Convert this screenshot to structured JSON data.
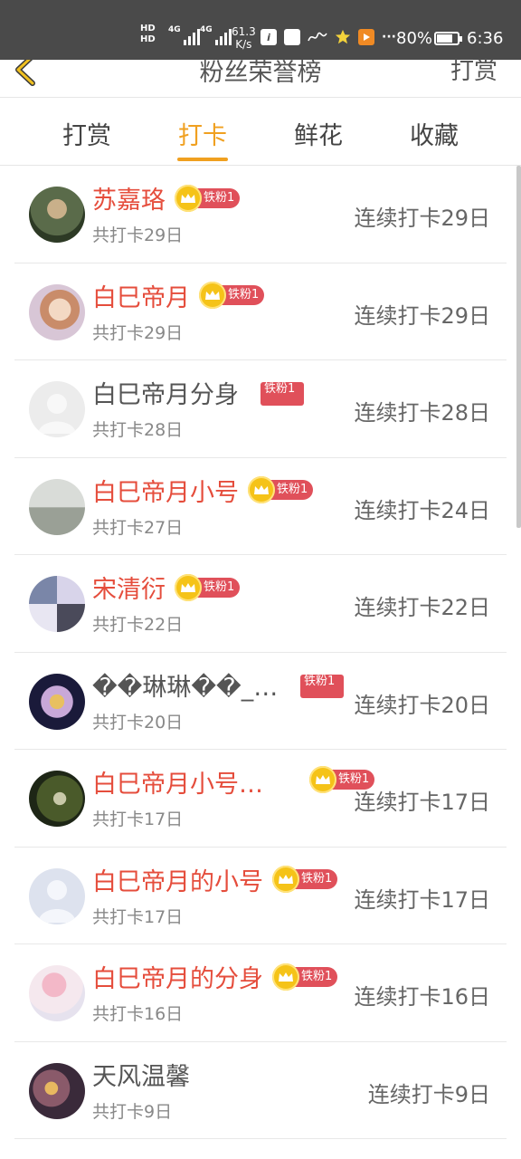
{
  "status_bar": {
    "hd1": "HD",
    "hd2": "HD",
    "net1": "4G",
    "net2": "4G",
    "speed_value": "61.3",
    "speed_unit": "K/s",
    "more": "···",
    "battery": "80%",
    "battery_level": 0.8,
    "time": "6:36"
  },
  "header": {
    "title": "粉丝荣誉榜",
    "right_label": "打赏"
  },
  "tabs": [
    {
      "label": "打赏",
      "active": false
    },
    {
      "label": "打卡",
      "active": true
    },
    {
      "label": "鲜花",
      "active": false
    },
    {
      "label": "收藏",
      "active": false
    }
  ],
  "badge_label": "铁粉1",
  "rows": [
    {
      "name": "苏嘉珞",
      "total": "共打卡29日",
      "streak": "连续打卡29日",
      "name_color": "red"
    },
    {
      "name": "白巳帝月",
      "total": "共打卡29日",
      "streak": "连续打卡29日",
      "name_color": "red"
    },
    {
      "name": "白巳帝月分身",
      "total": "共打卡28日",
      "streak": "连续打卡28日",
      "name_color": "gray"
    },
    {
      "name": "白巳帝月小号",
      "total": "共打卡27日",
      "streak": "连续打卡24日",
      "name_color": "red"
    },
    {
      "name": "宋清衍",
      "total": "共打卡22日",
      "streak": "连续打卡22日",
      "name_color": "red"
    },
    {
      "name": "��琳琳��_…",
      "total": "共打卡20日",
      "streak": "连续打卡20日",
      "name_color": "gray"
    },
    {
      "name": "白巳帝月小号…",
      "total": "共打卡17日",
      "streak": "连续打卡17日",
      "name_color": "red"
    },
    {
      "name": "白巳帝月的小号",
      "total": "共打卡17日",
      "streak": "连续打卡17日",
      "name_color": "red"
    },
    {
      "name": "白巳帝月的分身",
      "total": "共打卡16日",
      "streak": "连续打卡16日",
      "name_color": "red"
    },
    {
      "name": "天风温馨",
      "total": "共打卡9日",
      "streak": "连续打卡9日",
      "name_color": "gray"
    }
  ],
  "colors": {
    "accent": "#f0a020",
    "name_red": "#e54d3c",
    "badge_red": "#e0505a",
    "crown_gold": "#f5c318"
  }
}
